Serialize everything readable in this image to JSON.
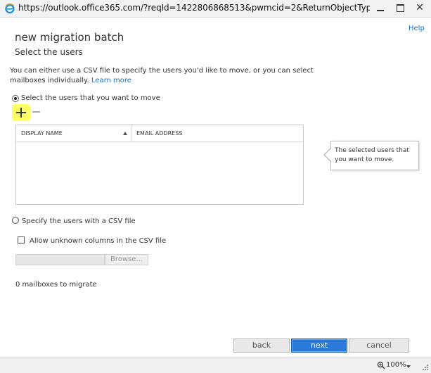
{
  "window": {
    "url": "https://outlook.office365.com/?reqId=1422806868513&pwmcid=2&ReturnObjectType=1&mi..."
  },
  "header": {
    "help_label": "Help",
    "title": "new migration batch",
    "subtitle": "Select the users"
  },
  "intro": {
    "text": "You can either use a CSV file to specify the users you'd like to move, or you can select mailboxes individually.",
    "learn_more": "Learn more"
  },
  "select_users": {
    "label": "Select the users that you want to move",
    "selected": true
  },
  "grid": {
    "columns": [
      "DISPLAY NAME",
      "EMAIL ADDRESS"
    ],
    "rows": []
  },
  "callout": {
    "text": "The selected users that you want to move."
  },
  "csv_option": {
    "label": "Specify the users with a CSV file",
    "selected": false,
    "allow_unknown_label": "Allow unknown columns in the CSV file",
    "allow_unknown_checked": false,
    "browse_label": "Browse..."
  },
  "mailbox_count": "0 mailboxes to migrate",
  "footer": {
    "back": "back",
    "next": "next",
    "cancel": "cancel"
  },
  "statusbar": {
    "zoom": "100%"
  },
  "colors": {
    "link": "#1e6fbf",
    "primary_button": "#2b79d9",
    "highlight": "#ffff66"
  },
  "icons": {
    "browser": "ie-icon",
    "add": "plus-icon",
    "remove": "minus-icon",
    "sort": "sort-ascending-icon",
    "zoom": "zoom-icon"
  }
}
